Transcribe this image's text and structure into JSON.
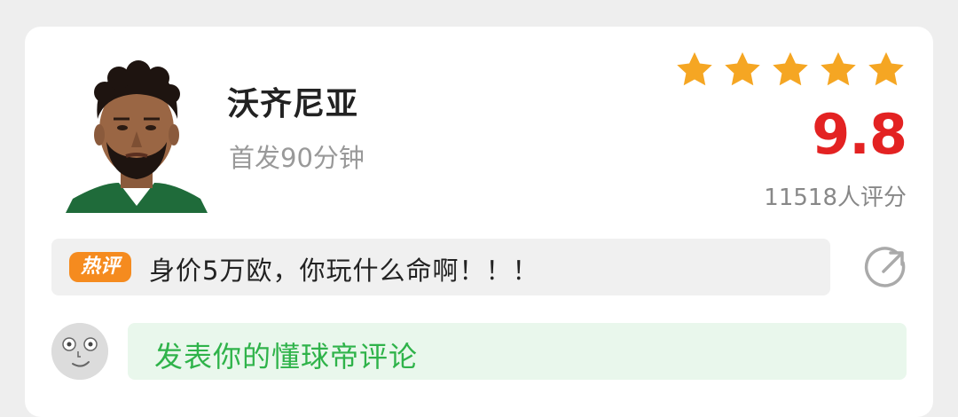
{
  "player": {
    "name": "沃齐尼亚",
    "subtitle": "首发90分钟"
  },
  "rating": {
    "stars": 5,
    "star_color": "#f5a623",
    "score": "9.8",
    "score_color": "#e32222",
    "count_text": "11518人评分"
  },
  "hot_comment": {
    "badge": "热评",
    "badge_color": "#f58b1f",
    "text": "身价5万欧，你玩什么命啊！！！"
  },
  "share": {
    "icon": "share-icon"
  },
  "comment_input": {
    "placeholder": "发表你的懂球帝评论",
    "accent_color": "#2fb34a"
  }
}
